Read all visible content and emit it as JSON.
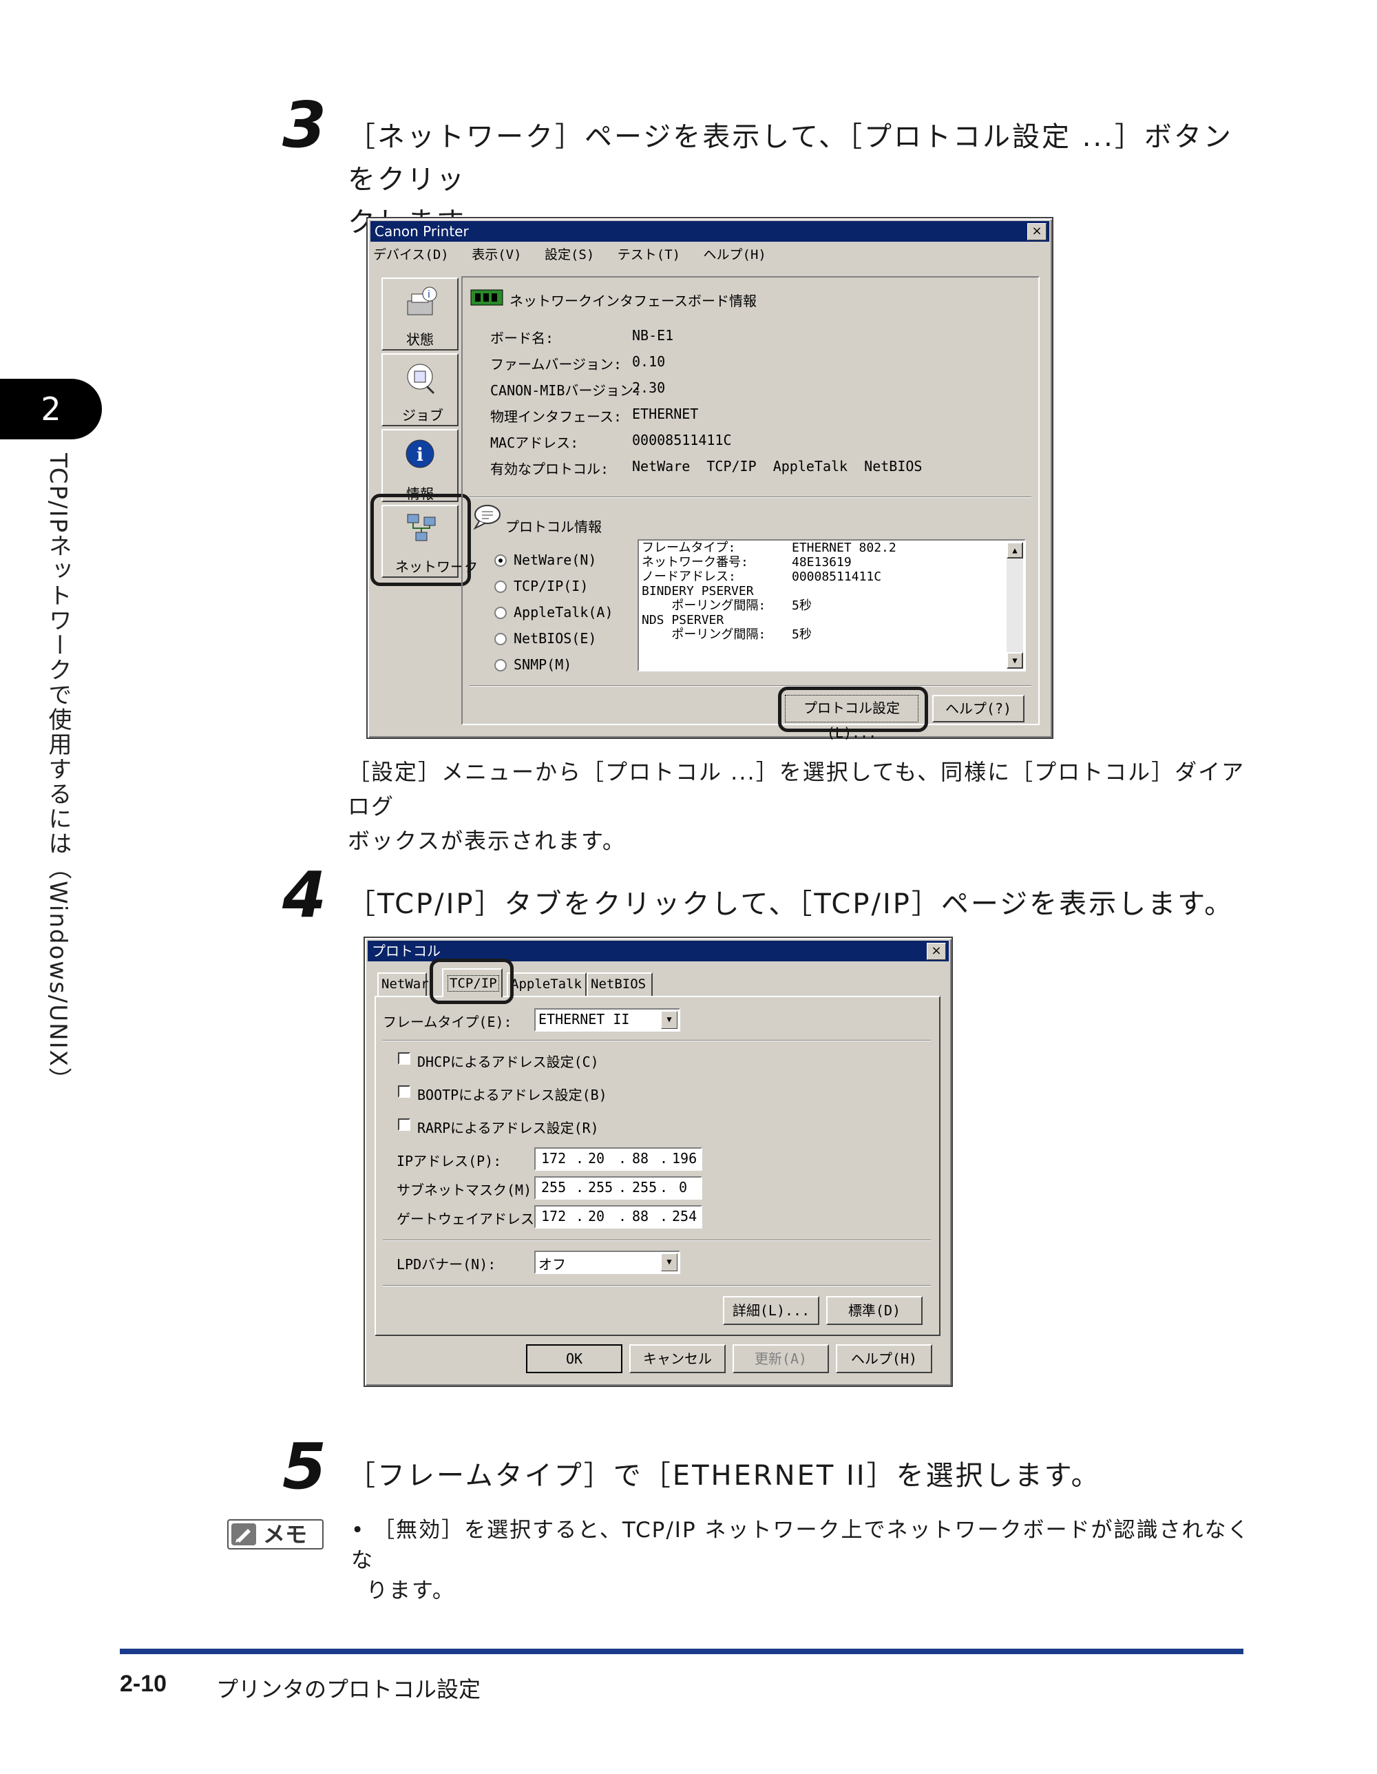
{
  "chapter": {
    "number": "2",
    "title": "TCP/IPネットワークで使用するには（Windows/UNIX）"
  },
  "step3": {
    "number": "3",
    "text_line1": "［ネットワーク］ページを表示して、［プロトコル設定 ...］ボタンをクリッ",
    "text_line2": "クします。",
    "note_line1": "［設定］メニューから［プロトコル ...］を選択しても、同様に［プロトコル］ダイアログ",
    "note_line2": "ボックスが表示されます。"
  },
  "printer_window": {
    "title": "Canon Printer",
    "close": "×",
    "menu": [
      "デバイス(D)",
      "表示(V)",
      "設定(S)",
      "テスト(T)",
      "ヘルプ(H)"
    ],
    "nav": [
      {
        "label": "状態",
        "icon": "printer-status-icon"
      },
      {
        "label": "ジョブ",
        "icon": "job-icon"
      },
      {
        "label": "情報",
        "icon": "info-icon"
      },
      {
        "label": "ネットワーク",
        "icon": "network-icon"
      }
    ],
    "board_section_title": "ネットワークインタフェースボード情報",
    "board_info": [
      {
        "label": "ボード名:",
        "value": "NB-E1"
      },
      {
        "label": "ファームバージョン:",
        "value": "0.10"
      },
      {
        "label": "CANON-MIBバージョン:",
        "value": "2.30"
      },
      {
        "label": "物理インタフェース:",
        "value": "ETHERNET"
      },
      {
        "label": "MACアドレス:",
        "value": "00008511411C"
      },
      {
        "label": "有効なプロトコル:",
        "value": "NetWare  TCP/IP  AppleTalk  NetBIOS"
      }
    ],
    "protocol_section_title": "プロトコル情報",
    "protocols": [
      {
        "label": "NetWare(N)",
        "selected": true
      },
      {
        "label": "TCP/IP(I)",
        "selected": false
      },
      {
        "label": "AppleTalk(A)",
        "selected": false
      },
      {
        "label": "NetBIOS(E)",
        "selected": false
      },
      {
        "label": "SNMP(M)",
        "selected": false
      }
    ],
    "protocol_detail_lines": [
      {
        "label": "フレームタイプ:",
        "value": "ETHERNET 802.2"
      },
      {
        "label": "ネットワーク番号:",
        "value": "48E13619"
      },
      {
        "label": "ノードアドレス:",
        "value": "00008511411C"
      },
      {
        "label": "BINDERY PSERVER",
        "value": ""
      },
      {
        "label": "    ポーリング間隔:",
        "value": "5秒"
      },
      {
        "label": "NDS PSERVER",
        "value": ""
      },
      {
        "label": "    ポーリング間隔:",
        "value": "5秒"
      }
    ],
    "protocol_settings_button": "プロトコル設定(L)...",
    "help_button": "ヘルプ(?)"
  },
  "step4": {
    "number": "4",
    "text": "［TCP/IP］タブをクリックして、［TCP/IP］ページを表示します。"
  },
  "protocol_dialog": {
    "title": "プロトコル",
    "close": "×",
    "tabs": [
      "NetWar",
      "TCP/IP",
      "AppleTalk",
      "NetBIOS"
    ],
    "frame_type_label": "フレームタイプ(E):",
    "frame_type_value": "ETHERNET II",
    "checkboxes": [
      "DHCPによるアドレス設定(C)",
      "BOOTPによるアドレス設定(B)",
      "RARPによるアドレス設定(R)"
    ],
    "ip_address_label": "IPアドレス(P):",
    "ip_address": [
      "172",
      "20",
      "88",
      "196"
    ],
    "subnet_label": "サブネットマスク(M):",
    "subnet": [
      "255",
      "255",
      "255",
      "0"
    ],
    "gateway_label": "ゲートウェイアドレス(G):",
    "gateway": [
      "172",
      "20",
      "88",
      "254"
    ],
    "lpd_label": "LPDバナー(N):",
    "lpd_value": "オフ",
    "detail_button": "詳細(L)...",
    "default_button": "標準(D)",
    "ok_button": "OK",
    "cancel_button": "キャンセル",
    "apply_button": "更新(A)",
    "help_button": "ヘルプ(H)"
  },
  "step5": {
    "number": "5",
    "text": "［フレームタイプ］で［ETHERNET II］を選択します。"
  },
  "memo": {
    "badge": "メモ",
    "line1": "• ［無効］を選択すると、TCP/IP ネットワーク上でネットワークボードが認識されなくな",
    "line2": "ります。"
  },
  "footer": {
    "page": "2-10",
    "title": "プリンタのプロトコル設定"
  }
}
